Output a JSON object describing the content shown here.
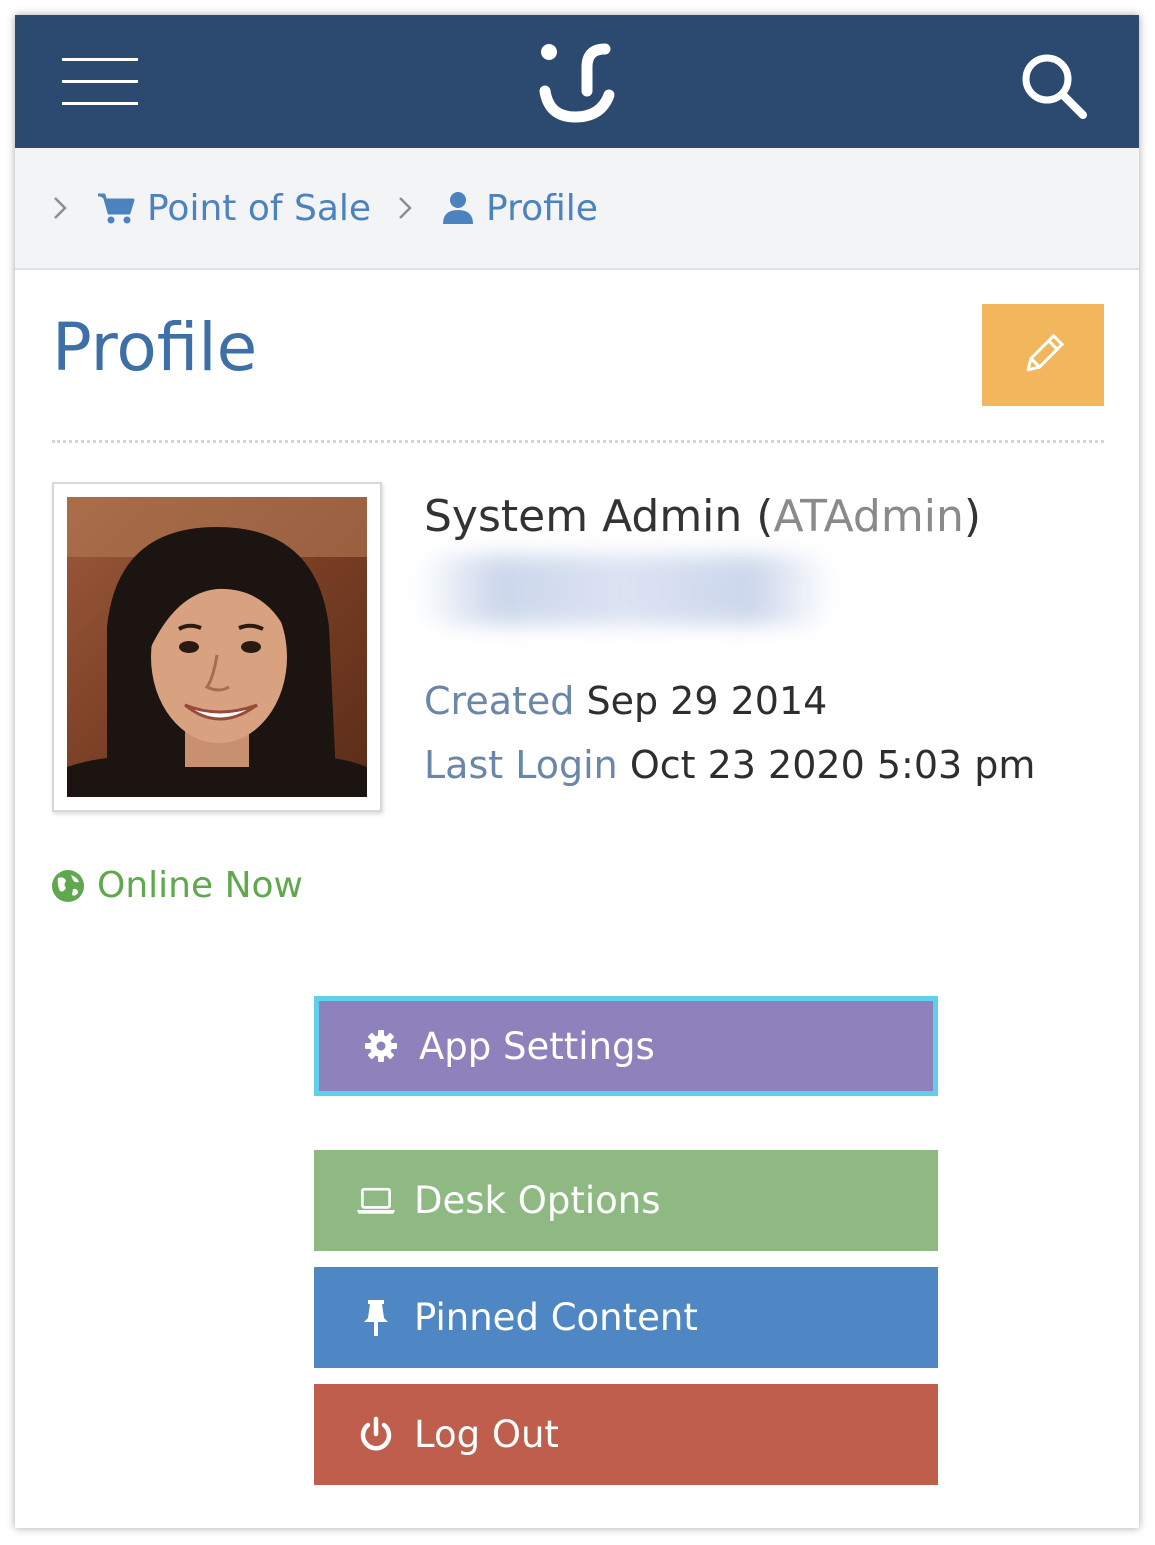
{
  "breadcrumb": {
    "items": [
      {
        "label": "Point of Sale",
        "icon": "cart-icon"
      },
      {
        "label": "Profile",
        "icon": "user-icon"
      }
    ]
  },
  "page": {
    "title": "Profile"
  },
  "profile": {
    "display_name": "System Admin",
    "username": "ATAdmin",
    "name_open": " (",
    "name_close": ")",
    "created_label": "Created",
    "created_value": "Sep 29 2014",
    "last_login_label": "Last Login",
    "last_login_value": "Oct 23 2020 5:03 pm",
    "status": "Online Now"
  },
  "actions": [
    {
      "label": "App Settings",
      "icon": "gear-icon",
      "color": "#8d82bc"
    },
    {
      "label": "Desk Options",
      "icon": "laptop-icon",
      "color": "#8fb982"
    },
    {
      "label": "Pinned Content",
      "icon": "pin-icon",
      "color": "#4f87c4"
    },
    {
      "label": "Log Out",
      "icon": "power-icon",
      "color": "#c05e4d"
    }
  ],
  "colors": {
    "header_bg": "#2c4a70",
    "edit_button": "#f2b65c",
    "link": "#4c82bd",
    "online": "#5fa84e",
    "focus_ring": "#5fd0ec"
  }
}
